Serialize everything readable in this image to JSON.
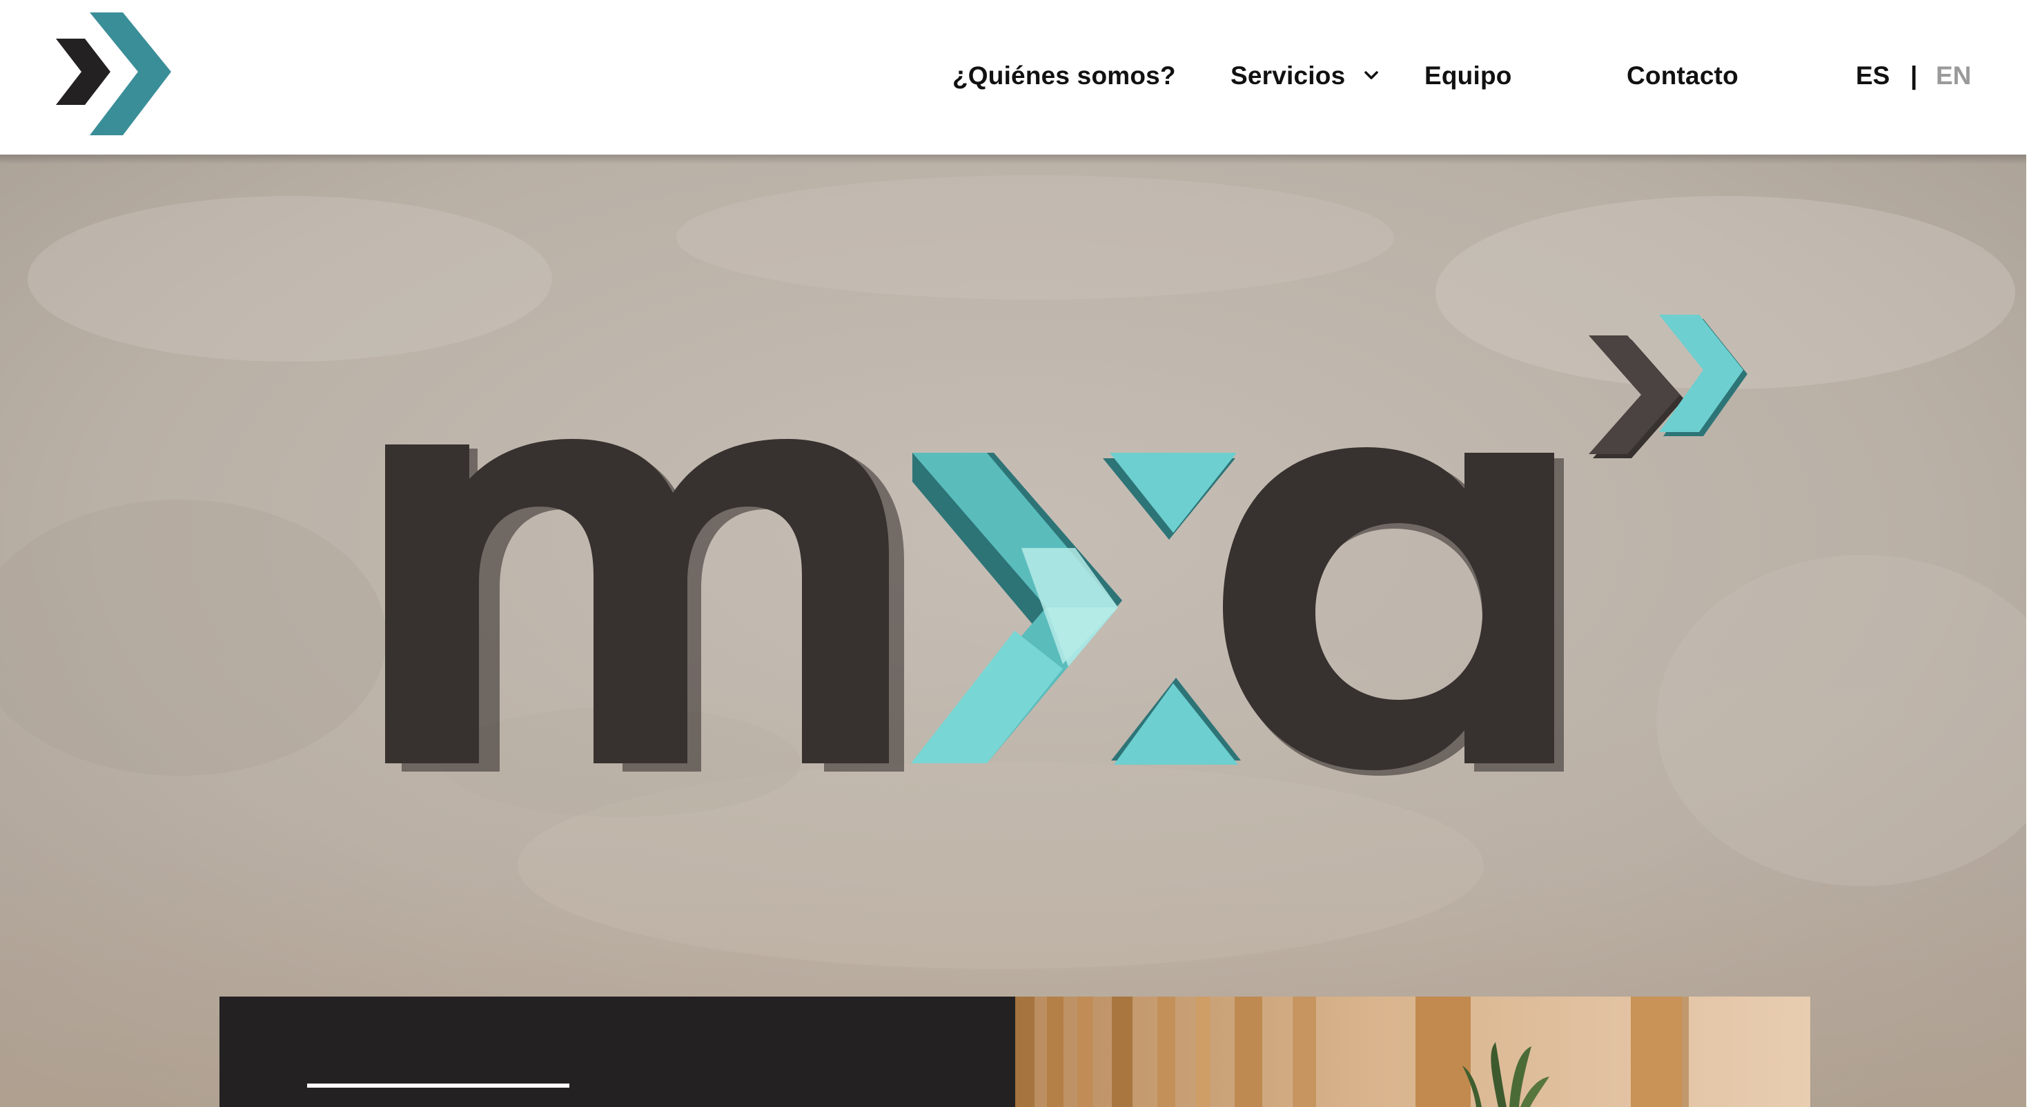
{
  "header": {
    "logo_alt": "mxa logo",
    "nav": {
      "quienes": "¿Quiénes somos?",
      "servicios": "Servicios",
      "equipo": "Equipo",
      "contacto": "Contacto"
    },
    "lang": {
      "es": "ES",
      "separator": "|",
      "en": "EN",
      "active": "ES"
    }
  },
  "hero": {
    "sign_text": "mxa",
    "wall_description_icon": "brand-sign-icon"
  },
  "cards": {
    "dark_card_icon": "divider-line",
    "photo_card_icon": "office-photo"
  },
  "colors": {
    "brand_teal": "#3a8e98",
    "sign_teal": "#6dcfcf",
    "sign_dark": "#37312f",
    "text": "#111111",
    "lang_inactive": "#9a9a9a",
    "card_dark": "#232122"
  },
  "icons": {
    "logo": "double-chevron-logo-icon",
    "servicios_dropdown": "chevron-down-icon"
  }
}
